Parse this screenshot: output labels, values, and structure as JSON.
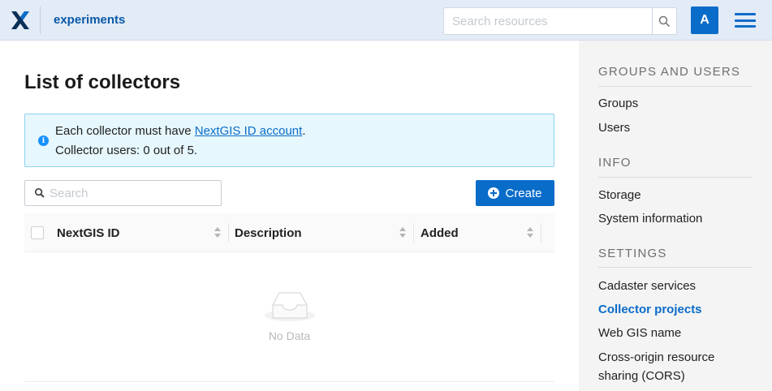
{
  "header": {
    "app_name": "experiments",
    "search_placeholder": "Search resources",
    "avatar_letter": "A",
    "accent_color": "#0a6cc9"
  },
  "main": {
    "title": "List of collectors",
    "alert": {
      "line1_prefix": "Each collector must have ",
      "line1_link": "NextGIS ID account",
      "line1_suffix": ".",
      "line2": "Collector users: 0 out of 5."
    },
    "search_placeholder": "Search",
    "create_label": "Create",
    "table": {
      "columns": [
        "NextGIS ID",
        "Description",
        "Added"
      ],
      "empty_text": "No Data"
    }
  },
  "sidebar": {
    "sections": [
      {
        "title": "GROUPS AND USERS",
        "items": [
          "Groups",
          "Users"
        ]
      },
      {
        "title": "INFO",
        "items": [
          "Storage",
          "System information"
        ]
      },
      {
        "title": "SETTINGS",
        "items": [
          "Cadaster services",
          "Collector projects",
          "Web GIS name",
          "Cross-origin resource sharing (CORS)"
        ]
      }
    ],
    "active_item": "Collector projects"
  }
}
